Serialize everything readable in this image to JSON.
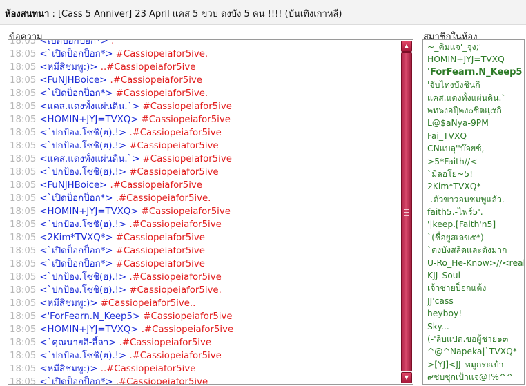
{
  "header": {
    "room_label": "ห้องสนทนา",
    "room_title": " : [Cass 5 Anniver] 23 April แคส 5 ขวบ ดงบัง 5 คน !!!! (บันเทิงเกาหลี)"
  },
  "labels": {
    "messages": "ข้อความ",
    "members": "สมาชิกในห้อง"
  },
  "messages": [
    {
      "time": "18:05",
      "nick": "<เปิดป็อกป็อก*>",
      "text": " .",
      "partial": true
    },
    {
      "time": "18:05",
      "nick": "<`เปิดป็อกป็อก*>",
      "text": " #Cassiopeiafor5ive."
    },
    {
      "time": "18:05",
      "nick": "<หมีสีชมพู:)>",
      "text": " ..#Cassiopeiafor5ive"
    },
    {
      "time": "18:05",
      "nick": "<FuNJHBoice>",
      "text": " .#Cassiopeiafor5ive"
    },
    {
      "time": "18:05",
      "nick": "<`เปิดป็อกป็อก*>",
      "text": " #Cassiopeiafor5ive."
    },
    {
      "time": "18:05",
      "nick": "<แคส.แดงทั้งแผ่นดิน.`>",
      "text": " #Cassiopeiafor5ive"
    },
    {
      "time": "18:05",
      "nick": "<HOMIN+JYJ=TVXQ>",
      "text": " #Cassiopeiafor5ive"
    },
    {
      "time": "18:05",
      "nick": "<`ปกป้อง.โซชิ(ฮ).!>",
      "text": " .#Cassiopeiafor5ive"
    },
    {
      "time": "18:05",
      "nick": "<`ปกป้อง.โซชิ(ฮ).!>",
      "text": " #Cassiopeiafor5ive"
    },
    {
      "time": "18:05",
      "nick": "<แคส.แดงทั้งแผ่นดิน.`>",
      "text": " #Cassiopeiafor5ive"
    },
    {
      "time": "18:05",
      "nick": "<`ปกป้อง.โซชิ(ฮ).!>",
      "text": " #Cassiopeiafor5ive"
    },
    {
      "time": "18:05",
      "nick": "<FuNJHBoice>",
      "text": " .#Cassiopeiafor5ive"
    },
    {
      "time": "18:05",
      "nick": "<`เปิดป็อกป็อก*>",
      "text": " .#Cassiopeiafor5ive."
    },
    {
      "time": "18:05",
      "nick": "<HOMIN+JYJ=TVXQ>",
      "text": " #Cassiopeiafor5ive"
    },
    {
      "time": "18:05",
      "nick": "<`ปกป้อง.โซชิ(ฮ).!>",
      "text": " .#Cassiopeiafor5ive"
    },
    {
      "time": "18:05",
      "nick": "<2Kim*TVXQ*>",
      "text": " #Cassiopeiafor5ive"
    },
    {
      "time": "18:05",
      "nick": "<`เปิดป็อกป็อก*>",
      "text": " #Cassiopeiafor5ive"
    },
    {
      "time": "18:05",
      "nick": "<`เปิดป็อกป็อก*>",
      "text": " #Cassiopeiafor5ive"
    },
    {
      "time": "18:05",
      "nick": "<`ปกป้อง.โซชิ(ฮ).!>",
      "text": " .#Cassiopeiafor5ive"
    },
    {
      "time": "18:05",
      "nick": "<`ปกป้อง.โซชิ(ฮ).!>",
      "text": " #Cassiopeiafor5ive."
    },
    {
      "time": "18:05",
      "nick": "<หมีสีชมพู:)>",
      "text": " #Cassiopeiafor5ive.."
    },
    {
      "time": "18:05",
      "nick": "<'ForFearn.N_Keep5>",
      "text": " #Cassiopeiafor5ive"
    },
    {
      "time": "18:05",
      "nick": "<HOMIN+JYJ=TVXQ>",
      "text": " .#Cassiopeiafor5ive"
    },
    {
      "time": "18:05",
      "nick": "<`คุณนายอิ-ลี้ลา>",
      "text": " .#Cassiopeiafor5ive"
    },
    {
      "time": "18:05",
      "nick": "<`ปกป้อง.โซชิ(ฮ).!>",
      "text": " .#Cassiopeiafor5ive"
    },
    {
      "time": "18:05",
      "nick": "<หมีสีชมพู:)>",
      "text": " ..#Cassiopeiafor5ive"
    },
    {
      "time": "18:05",
      "nick": "<`เปิดป็อกป็อก*>",
      "text": " .#Cassiopeiafor5ive"
    }
  ],
  "members": [
    {
      "name": "~_คิมแจ'_จุง;'"
    },
    {
      "name": "HOMIN+JYJ=TVXQ"
    },
    {
      "name": "'ForFearn.N_Keep5",
      "bold": true
    },
    {
      "name": "'จับไทงบังชินกิ"
    },
    {
      "name": "แคส.แดงทั้งแผ่นดิน.`"
    },
    {
      "name": "๒ท๖งอปีฺ๒ง๐ชิตแฺ๕กิ"
    },
    {
      "name": "L@$aNya-9PM"
    },
    {
      "name": "Fai_TVXQ"
    },
    {
      "name": "CNแบลุ''บ๊อยซ์,"
    },
    {
      "name": ">5*Faith//<"
    },
    {
      "name": "`มิลอโย~5!"
    },
    {
      "name": "2Kim*TVXQ*"
    },
    {
      "name": "-.ตัวขาวอมชมพูแล้ว.-"
    },
    {
      "name": "faith5.-ไฟร์5'."
    },
    {
      "name": "'|keep.[Faith'n5]"
    },
    {
      "name": "`(ชื่อยูสเลข๕*)"
    },
    {
      "name": "`ดงบังสลิดและดังมาก"
    },
    {
      "name": "U-Ro_He-Know>//<real"
    },
    {
      "name": "KJJ_Soul"
    },
    {
      "name": "เจ้าชายป็อกแต้ง"
    },
    {
      "name": "JJ'cass"
    },
    {
      "name": "heyboy!"
    },
    {
      "name": "Sky..."
    },
    {
      "name": "(-'ลิบแปด.ขอผู้ชาย๑๓"
    },
    {
      "name": "^@^Napeka|`TVXQ*"
    },
    {
      "name": ">[YJ]<JJ_หมูกระเป๋า"
    },
    {
      "name": "๙ชบชุกเป้าแจ@!%^^"
    }
  ],
  "colors": {
    "timestamp": "#b6b6b6",
    "nick": "#1b2bd6",
    "message": "#e11d1d",
    "member": "#2c7a26",
    "scrollbar": "#c0304f"
  },
  "icons": {
    "scroll_up": "triangle-up-icon",
    "scroll_down": "triangle-down-icon"
  }
}
